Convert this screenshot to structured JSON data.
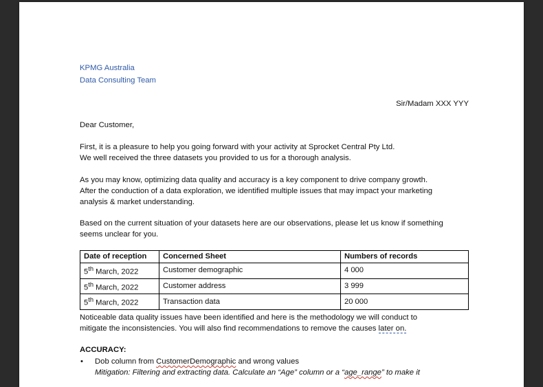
{
  "letterhead": {
    "company": "KPMG Australia",
    "team": "Data Consulting Team"
  },
  "recipient": "Sir/Madam XXX YYY",
  "greeting": "Dear Customer,",
  "paragraph1": {
    "line1": "First, it is a pleasure to help you going forward with your activity at Sprocket Central Pty Ltd.",
    "line2": "We well received the three datasets you provided to us for a thorough analysis."
  },
  "paragraph2": {
    "line1": "As you may know, optimizing data quality and accuracy is a key component to drive company growth.",
    "line2": "After the conduction of a data exploration, we identified multiple issues that may impact your marketing",
    "line3": "analysis & market understanding."
  },
  "paragraph3": {
    "line1": "Based on the current situation of your datasets here are our observations, please let us know if something",
    "line2": "seems unclear for you."
  },
  "table": {
    "headers": [
      "Date of reception",
      "Concerned Sheet",
      "Numbers of records"
    ],
    "rows": [
      {
        "day": "5",
        "suffix": "th",
        "date_rest": " March, 2022",
        "sheet": "Customer demographic",
        "records": "4 000"
      },
      {
        "day": "5",
        "suffix": "th",
        "date_rest": " March, 2022",
        "sheet": "Customer address",
        "records": "3 999"
      },
      {
        "day": "5",
        "suffix": "th",
        "date_rest": " March, 2022",
        "sheet": "Transaction data",
        "records": "20 000"
      }
    ]
  },
  "paragraph4": {
    "line1": "Noticeable data quality issues have been identified and here is the methodology we will conduct to",
    "line2_main": "mitigate the inconsistencies. You will also find recommendations to remove the causes ",
    "line2_link": "later on."
  },
  "accuracy": {
    "heading": "ACCURACY:",
    "bullet_symbol": "•",
    "item1": {
      "text_before": "Dob column from ",
      "text_flagged": "CustomerDemographic",
      "text_after": " and wrong values",
      "mitigation_before": "Mitigation: Filtering and extracting data. Calculate an “Age” column or a “",
      "mitigation_flagged": "age_range",
      "mitigation_after": "” to make it"
    }
  }
}
